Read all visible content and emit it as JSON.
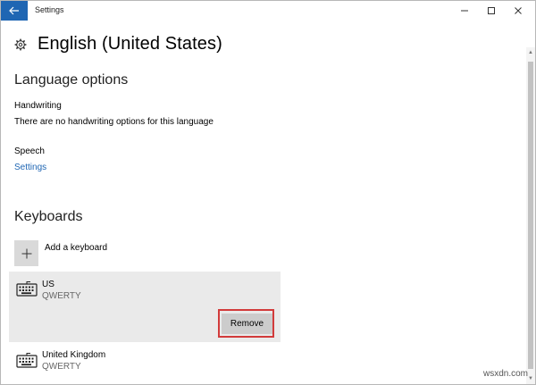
{
  "window": {
    "title": "Settings"
  },
  "header": {
    "title": "English (United States)"
  },
  "language_options": {
    "heading": "Language options",
    "handwriting": {
      "label": "Handwriting",
      "description": "There are no handwriting options for this language"
    },
    "speech": {
      "label": "Speech",
      "link": "Settings"
    }
  },
  "keyboards": {
    "heading": "Keyboards",
    "add_label": "Add a keyboard",
    "items": [
      {
        "name": "US",
        "layout": "QWERTY",
        "selected": true,
        "action": "Remove"
      },
      {
        "name": "United Kingdom",
        "layout": "QWERTY",
        "selected": false
      }
    ]
  },
  "watermark": "wsxdn.com",
  "colors": {
    "accent": "#1f66b3",
    "highlight": "#d23b3b",
    "selected_bg": "#eaeaea"
  }
}
